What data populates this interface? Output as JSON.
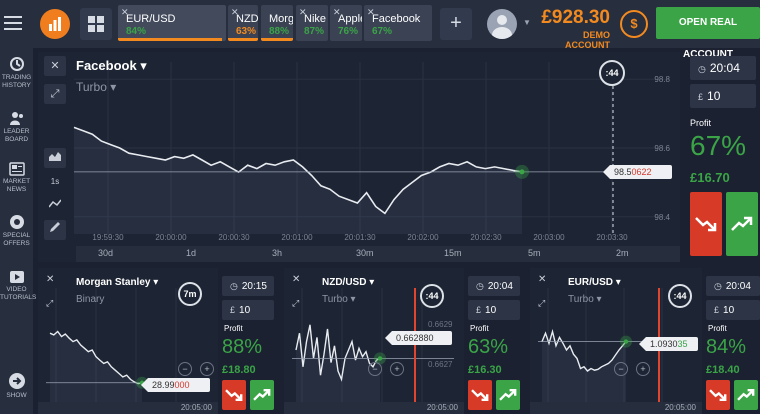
{
  "colors": {
    "accent": "#f28a1f",
    "call": "#3aa447",
    "put": "#d83a28",
    "expiry": "#e0452f"
  },
  "topbar": {
    "tabs": [
      {
        "name": "EUR/USD",
        "pct": "84%",
        "pct_color": "#3aa447",
        "bar_color": "#f28a1f",
        "active": true
      },
      {
        "name": "NZD/",
        "pct": "63%",
        "pct_color": "#f28a1f",
        "bar_color": "#f28a1f"
      },
      {
        "name": "Morg",
        "pct": "88%",
        "pct_color": "#3aa447",
        "bar_color": "#f28a1f"
      },
      {
        "name": "Nike",
        "pct": "87%",
        "pct_color": "#3aa447",
        "bar_color": "#2a3140"
      },
      {
        "name": "Apple",
        "pct": "76%",
        "pct_color": "#3aa447",
        "bar_color": "#2a3140"
      },
      {
        "name": "Facebook",
        "pct": "67%",
        "pct_color": "#3aa447",
        "bar_color": "#2a3140"
      }
    ],
    "add_icon": "+",
    "balance": "£928.30",
    "balance_sub": "DEMO ACCOUNT",
    "exchange_icon": "$",
    "open_real_label": "OPEN REAL ACCOUNT"
  },
  "sidebar": {
    "items": [
      {
        "label1": "TRADING",
        "label2": "HISTORY",
        "icon": "history-icon"
      },
      {
        "label1": "LEADER",
        "label2": "BOARD",
        "icon": "leaderboard-icon"
      },
      {
        "label1": "MARKET",
        "label2": "NEWS",
        "icon": "news-icon"
      },
      {
        "label1": "SPECIAL",
        "label2": "OFFERS",
        "icon": "offers-icon"
      },
      {
        "label1": "VIDEO",
        "label2": "TUTORIALS",
        "icon": "video-icon"
      },
      {
        "label1": "SHOW",
        "label2": "",
        "icon": "arrow-right-icon"
      }
    ]
  },
  "main": {
    "close_icon": "✕",
    "expand_icon": "⤢",
    "asset": "Facebook ▾",
    "type": "Turbo ▾",
    "timer": ":44",
    "price_prefix": "98.5",
    "price_suffix": "0622",
    "x_ticks": [
      "19:59:30",
      "20:00:00",
      "20:00:30",
      "20:01:00",
      "20:01:30",
      "20:02:00",
      "20:02:30",
      "20:03:00",
      "20:03:30"
    ],
    "y_ticks": [
      "98.8",
      "98.6",
      "98.4"
    ],
    "left_tools": [
      "1s"
    ],
    "timeframes": [
      "30d",
      "1d",
      "3h",
      "30m",
      "15m",
      "5m",
      "2m"
    ],
    "price_series": [
      98.66,
      98.65,
      98.64,
      98.62,
      98.61,
      98.6,
      98.585,
      98.58,
      98.575,
      98.57,
      98.565,
      98.575,
      98.57,
      98.58,
      98.565,
      98.55,
      98.56,
      98.545,
      98.53,
      98.55,
      98.54,
      98.555,
      98.55,
      98.56,
      98.565,
      98.545,
      98.52,
      98.49,
      98.48,
      98.46,
      98.45,
      98.44,
      98.47,
      98.43,
      98.41,
      98.45,
      98.48,
      98.5,
      98.52,
      98.53,
      98.545,
      98.555,
      98.55,
      98.56,
      98.545,
      98.54,
      98.545,
      98.54,
      98.535,
      98.5306
    ]
  },
  "trade": {
    "time": "20:04",
    "amount": "10",
    "currency_icon": "£",
    "clock_icon": "◷",
    "profit_label": "Profit",
    "profit_pct": "67%",
    "profit_amt": "£16.70"
  },
  "minis": [
    {
      "asset": "Morgan Stanley ▾",
      "type": "Binary",
      "timer": "7m",
      "price_prefix": "28.99",
      "price_suffix": "000",
      "side_tick": "29",
      "time": "20:15",
      "amount": "10",
      "profit_pct": "88%",
      "profit_amt": "£18.80",
      "x_tick": "20:05:00",
      "series": [
        0.3,
        0.32,
        0.28,
        0.34,
        0.31,
        0.36,
        0.4,
        0.38,
        0.44,
        0.48,
        0.52,
        0.5,
        0.58,
        0.62,
        0.66,
        0.64,
        0.7,
        0.74,
        0.78,
        0.82,
        0.8,
        0.85,
        0.88,
        0.9,
        0.89
      ]
    },
    {
      "asset": "NZD/USD ▾",
      "type": "Turbo ▾",
      "timer": ":44",
      "price_prefix": "0.662880",
      "price_suffix": "",
      "y_top": "0.6629",
      "y_bottom": "0.6627",
      "time": "20:04",
      "amount": "10",
      "profit_pct": "63%",
      "profit_amt": "£16.30",
      "x_tick": "20:05:00",
      "series": [
        0.5,
        0.3,
        0.7,
        0.4,
        0.2,
        0.6,
        0.35,
        0.8,
        0.55,
        0.25,
        0.65,
        0.45,
        0.75,
        0.85,
        0.6,
        0.5,
        0.4,
        0.62,
        0.48,
        0.58,
        0.52,
        0.66,
        0.7,
        0.62,
        0.6
      ]
    },
    {
      "asset": "EUR/USD ▾",
      "type": "Turbo ▾",
      "timer": ":44",
      "price_prefix": "1.0930",
      "price_suffix": "35",
      "time": "20:04",
      "amount": "10",
      "profit_pct": "84%",
      "profit_amt": "£18.40",
      "x_tick": "20:05:00",
      "series": [
        0.4,
        0.3,
        0.42,
        0.28,
        0.45,
        0.35,
        0.42,
        0.5,
        0.45,
        0.55,
        0.6,
        0.72,
        0.7,
        0.75,
        0.72,
        0.74,
        0.73,
        0.7,
        0.68,
        0.66,
        0.62,
        0.56,
        0.5,
        0.45,
        0.4
      ]
    }
  ]
}
